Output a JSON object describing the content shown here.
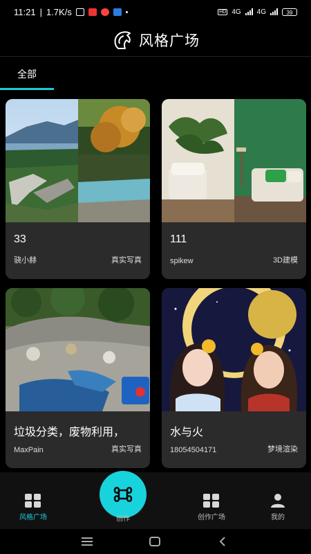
{
  "status_bar": {
    "time": "11:21",
    "speed": "1.7K/s",
    "battery": "39",
    "network": "4G"
  },
  "header": {
    "title": "风格广场",
    "logo_icon": "horse-head-icon"
  },
  "tabs": [
    {
      "label": "全部",
      "active": true
    }
  ],
  "cards": [
    {
      "title": "33",
      "author": "骁小赫",
      "tag": "真实写真",
      "image": "landscape-comparison"
    },
    {
      "title": "111",
      "author": "spikew",
      "tag": "3D建模",
      "image": "interior-comparison"
    },
    {
      "title": "垃圾分类，废物利用，",
      "author": "MaxPain",
      "tag": "真实写真",
      "image": "garbage-dump"
    },
    {
      "title": "水与火",
      "author": "18054504171",
      "tag": "梦境渲染",
      "image": "anime-girl-moon"
    }
  ],
  "bottom_nav": {
    "items": [
      {
        "label": "风格广场",
        "icon": "grid-icon",
        "active": true
      },
      {
        "label": "创作",
        "icon": "command-icon"
      },
      {
        "label": "创作广场",
        "icon": "grid-icon"
      },
      {
        "label": "我的",
        "icon": "person-icon"
      }
    ]
  },
  "colors": {
    "accent": "#1ccad8",
    "card_bg": "#2b2b2b",
    "background": "#000000"
  }
}
